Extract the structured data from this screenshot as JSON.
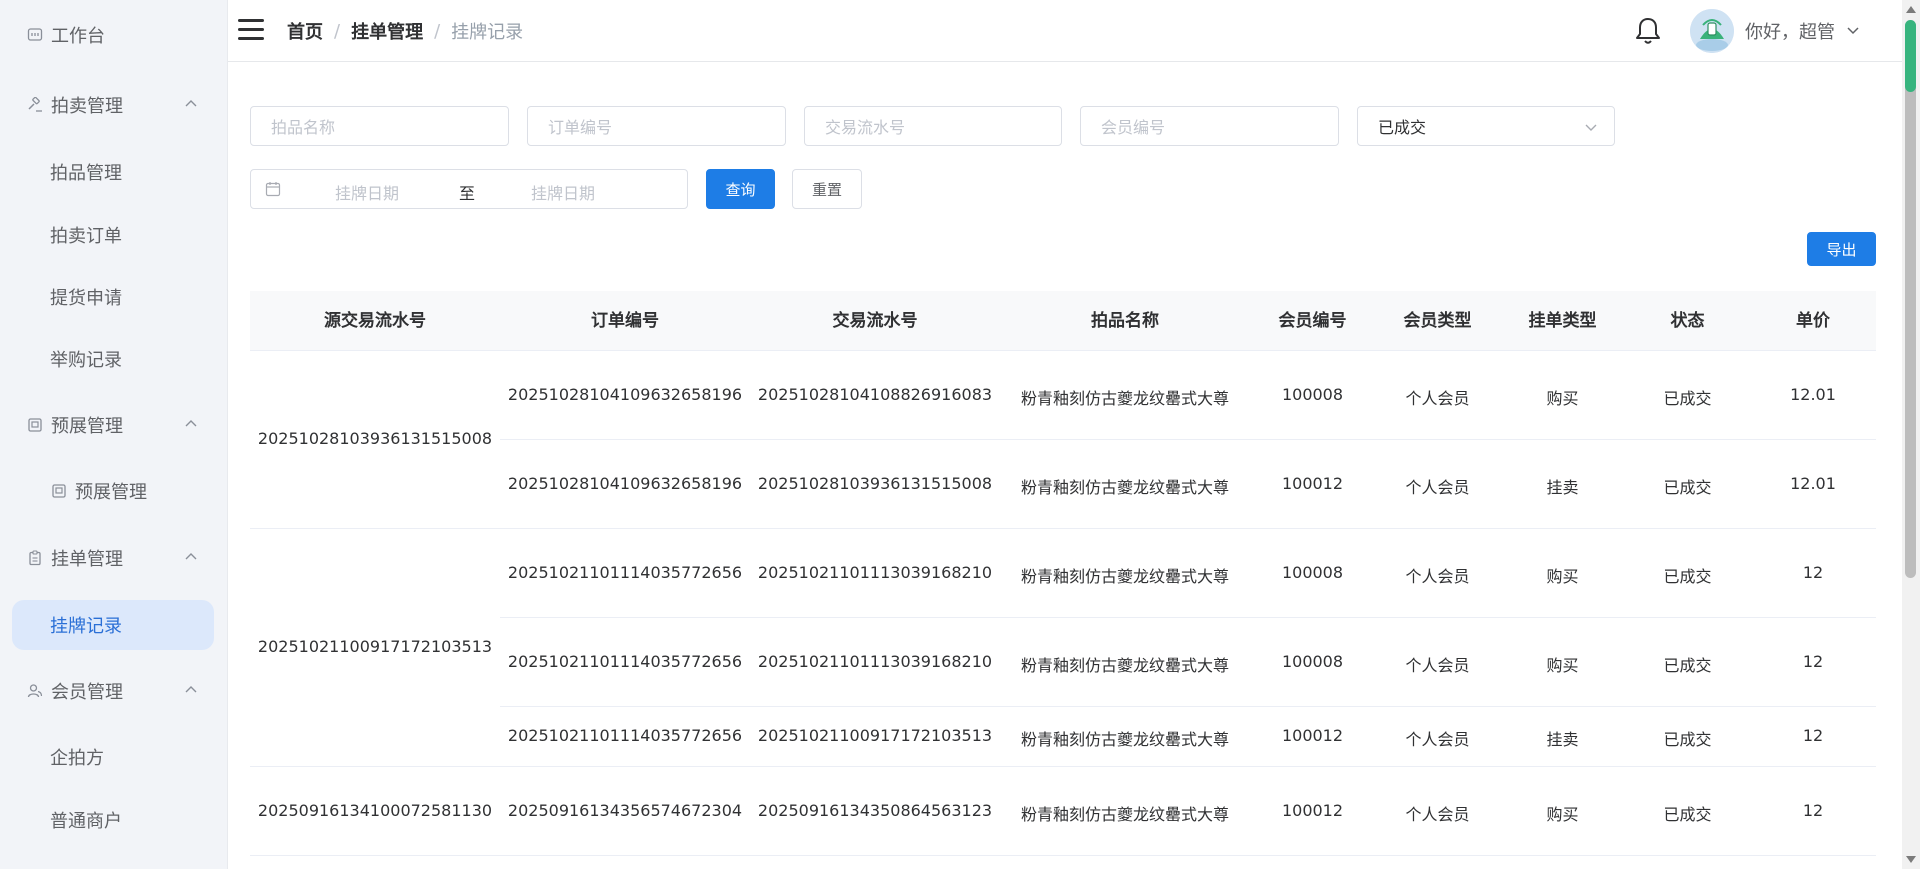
{
  "sidebar": {
    "items": [
      {
        "label": "工作台",
        "icon": "dashboard-icon"
      },
      {
        "label": "拍卖管理",
        "icon": "gavel-icon"
      },
      {
        "label": "拍品管理"
      },
      {
        "label": "拍卖订单"
      },
      {
        "label": "提货申请"
      },
      {
        "label": "举购记录"
      },
      {
        "label": "预展管理",
        "icon": "exhibition-icon"
      },
      {
        "label": "预展管理",
        "icon": "exhibition-icon"
      },
      {
        "label": "挂单管理",
        "icon": "clipboard-icon"
      },
      {
        "label": "挂牌记录"
      },
      {
        "label": "会员管理",
        "icon": "users-icon"
      },
      {
        "label": "企拍方"
      },
      {
        "label": "普通商户"
      }
    ]
  },
  "header": {
    "breadcrumb": [
      "首页",
      "挂单管理",
      "挂牌记录"
    ],
    "greeting": "你好，超管"
  },
  "filters": {
    "item_name_placeholder": "拍品名称",
    "order_no_placeholder": "订单编号",
    "trade_no_placeholder": "交易流水号",
    "member_no_placeholder": "会员编号",
    "status_value": "已成交",
    "date_start_placeholder": "挂牌日期",
    "date_separator": "至",
    "date_end_placeholder": "挂牌日期",
    "query_label": "查询",
    "reset_label": "重置",
    "export_label": "导出"
  },
  "table": {
    "columns": [
      "源交易流水号",
      "订单编号",
      "交易流水号",
      "拍品名称",
      "会员编号",
      "会员类型",
      "挂单类型",
      "状态",
      "单价"
    ],
    "groups": [
      {
        "source_trade_no": "2025102810393613151500​8",
        "rows": [
          {
            "order_no": "20251028104109632658196",
            "trade_no": "20251028104108826916083",
            "item_name": "粉青釉刻仿古夔龙纹罍式大尊",
            "member_no": "100008",
            "member_type": "个人会员",
            "listing_type": "购买",
            "status": "已成交",
            "price": "12.01"
          },
          {
            "order_no": "20251028104109632658196",
            "trade_no": "20251028103936131515008",
            "item_name": "粉青釉刻仿古夔龙纹罍式大尊",
            "member_no": "100012",
            "member_type": "个人会员",
            "listing_type": "挂卖",
            "status": "已成交",
            "price": "12.01"
          }
        ]
      },
      {
        "source_trade_no": "20251021100917172103513",
        "rows": [
          {
            "order_no": "20251021101114035772656",
            "trade_no": "20251021101113039168210",
            "item_name": "粉青釉刻仿古夔龙纹罍式大尊",
            "member_no": "100008",
            "member_type": "个人会员",
            "listing_type": "购买",
            "status": "已成交",
            "price": "12"
          },
          {
            "order_no": "20251021101114035772656",
            "trade_no": "20251021101113039168210",
            "item_name": "粉青釉刻仿古夔龙纹罍式大尊",
            "member_no": "100008",
            "member_type": "个人会员",
            "listing_type": "购买",
            "status": "已成交",
            "price": "12"
          },
          {
            "order_no": "20251021101114035772656",
            "trade_no": "20251021100917172103513",
            "item_name": "粉青釉刻仿古夔龙纹罍式大尊",
            "member_no": "100012",
            "member_type": "个人会员",
            "listing_type": "挂卖",
            "status": "已成交",
            "price": "12"
          }
        ]
      },
      {
        "source_trade_no": "20250916134100072581130",
        "rows": [
          {
            "order_no": "20250916134356574672304",
            "trade_no": "20250916134350864563123",
            "item_name": "粉青釉刻仿古夔龙纹罍式大尊",
            "member_no": "100012",
            "member_type": "个人会员",
            "listing_type": "购买",
            "status": "已成交",
            "price": "12"
          }
        ]
      }
    ]
  },
  "colors": {
    "primary": "#1e7de6",
    "active_menu_bg": "#dce8fb",
    "active_menu_text": "#2a6fd6",
    "sidebar_bg": "#f2f4f8"
  }
}
